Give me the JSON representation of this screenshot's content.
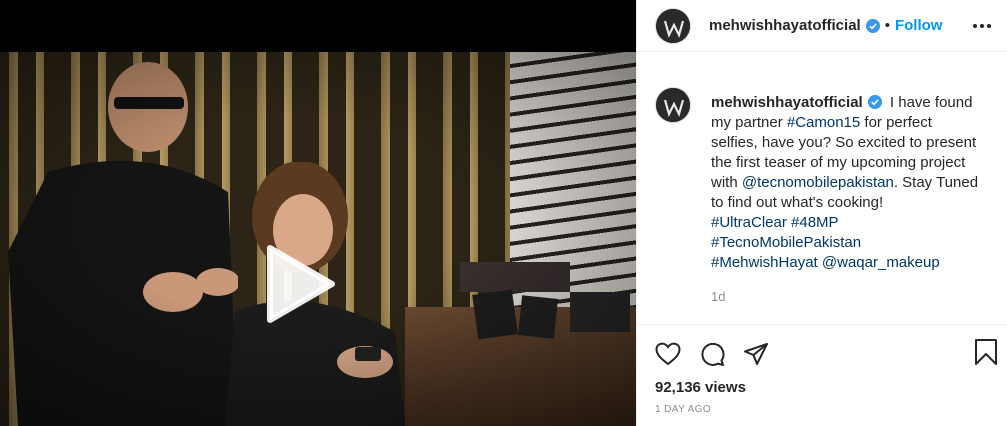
{
  "post": {
    "username": "mehwishhayatofficial",
    "follow_label": "Follow",
    "separator": "•"
  },
  "caption": {
    "username": "mehwishhayatofficial",
    "text_1": " I have found my partner ",
    "hashtag_camon": "#Camon15",
    "text_2": " for perfect selfies, have you? So excited to present the first teaser of my upcoming project with ",
    "mention_tecno": "@tecnomobilepakistan",
    "text_3": ". Stay Tuned to find out what's cooking!",
    "hashtag_ultraclear": "#UltraClear",
    "hashtag_48mp": "#48MP",
    "hashtag_tecno": "#TecnoMobilePakistan",
    "hashtag_mehwish": "#MehwishHayat",
    "mention_waqar": "@waqar_makeup",
    "time": "1d"
  },
  "stats": {
    "views": "92,136 views",
    "posted": "1 DAY AGO"
  },
  "colors": {
    "accent": "#0095f6",
    "link": "#00376b",
    "verified": "#3897f0",
    "muted": "#8e8e8e"
  },
  "icons": {
    "play": "play-icon",
    "more": "more-options-icon",
    "like": "heart-icon",
    "comment": "comment-icon",
    "share": "share-icon",
    "save": "bookmark-icon",
    "verified": "verified-badge-icon"
  }
}
